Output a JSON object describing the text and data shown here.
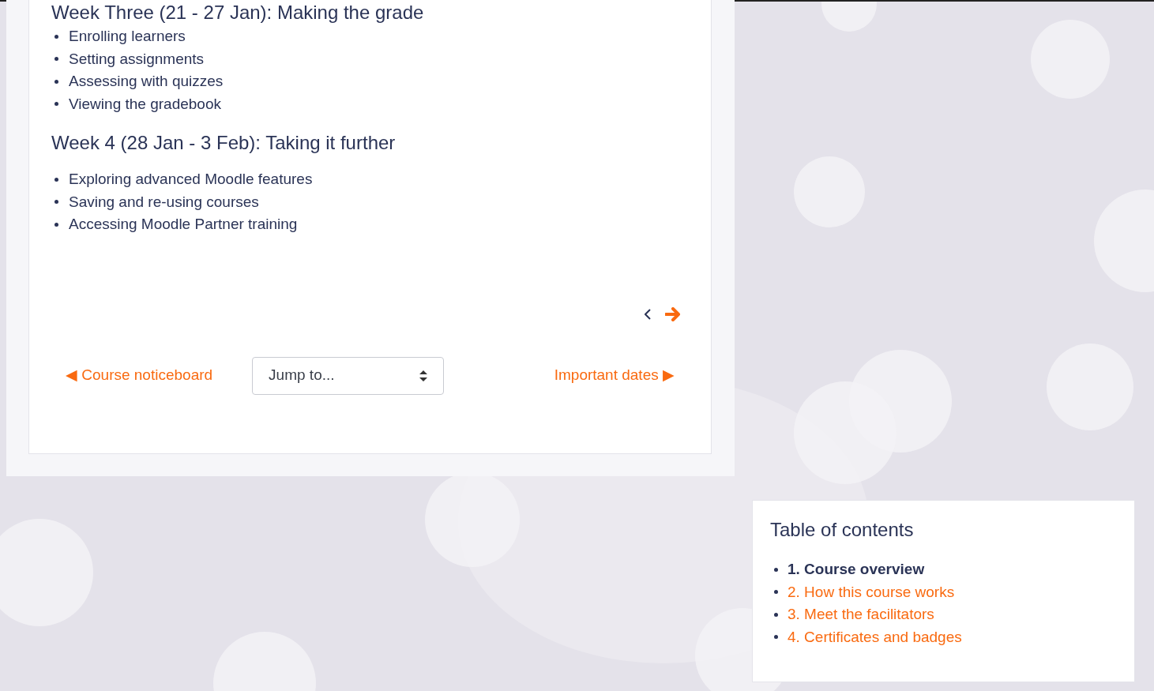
{
  "section": {
    "cut_heading": "Week Three (21 - 27 Jan): Making the grade",
    "week_three_items": [
      "Enrolling learners",
      "Setting assignments",
      "Assessing with quizzes",
      "Viewing the gradebook"
    ],
    "week_four_heading": "Week 4 (28 Jan - 3 Feb): Taking it further",
    "week_four_items": [
      "Exploring advanced Moodle features",
      "Saving and re-using courses",
      "Accessing Moodle Partner training"
    ]
  },
  "navigation": {
    "previous_link": "◀ Course noticeboard",
    "jump_select": {
      "value": "Jump to..."
    },
    "next_link": "Important dates ▶"
  },
  "table_of_contents": {
    "title": "Table of contents",
    "items": [
      {
        "label": "1. Course overview",
        "selected": true
      },
      {
        "label": "2. How this course works",
        "selected": false
      },
      {
        "label": "3. Meet the facilitators",
        "selected": false
      },
      {
        "label": "4. Certificates and badges",
        "selected": false
      }
    ]
  }
}
